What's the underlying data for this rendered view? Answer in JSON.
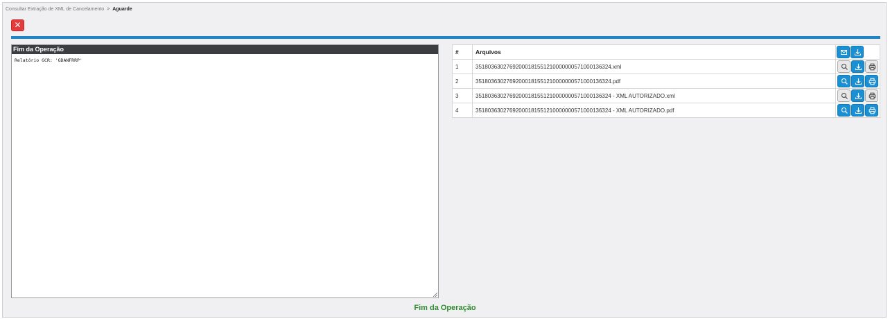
{
  "breadcrumb": {
    "parent": "Consultar Extração de XML de Cancelamento",
    "separator": ">",
    "current": "Aguarde"
  },
  "close_button": {
    "label": "✕"
  },
  "log_panel": {
    "title": "Fim da Operação",
    "content": "Relatório GCR: 'GDANFRRP'"
  },
  "files_table": {
    "headers": {
      "num": "#",
      "name": "Arquivos"
    },
    "header_actions": [
      "envelope-icon",
      "download-icon"
    ],
    "rows": [
      {
        "num": "1",
        "name": "35180363027692000181551210000000571000136324.xml",
        "search_style": "gray",
        "print_style": "gray"
      },
      {
        "num": "2",
        "name": "35180363027692000181551210000000571000136324.pdf",
        "search_style": "blue",
        "print_style": "blue"
      },
      {
        "num": "3",
        "name": "35180363027692000181551210000000571000136324 - XML AUTORIZADO.xml",
        "search_style": "gray",
        "print_style": "gray"
      },
      {
        "num": "4",
        "name": "35180363027692000181551210000000571000136324 - XML AUTORIZADO.pdf",
        "search_style": "blue",
        "print_style": "blue"
      }
    ]
  },
  "status": {
    "text": "Fim da Operação"
  },
  "colors": {
    "accent_blue": "#1c86c6",
    "danger_red": "#e23b3b",
    "success_green": "#2e8b2e",
    "panel_header": "#3b3d40"
  }
}
